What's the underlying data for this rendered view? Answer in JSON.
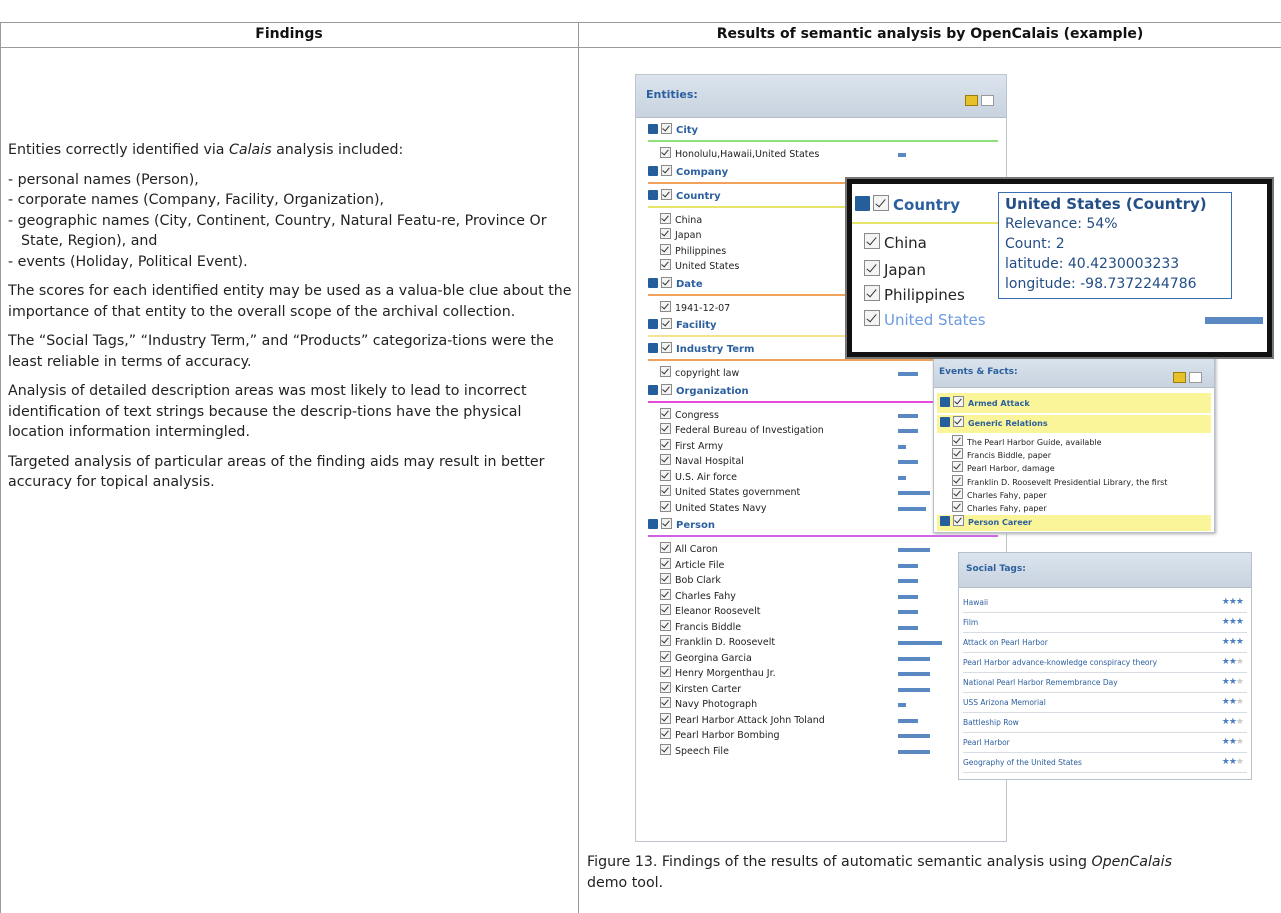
{
  "table": {
    "col1_header": "Findings",
    "col2_header": "Results of semantic analysis by OpenCalais (example)"
  },
  "findings": {
    "intro_prefix": "Entities correctly identified via ",
    "intro_italic": "Calais",
    "intro_suffix": " analysis included:",
    "list": [
      "- personal names (Person),",
      "- corporate names (Company, Facility, Organization),",
      "- geographic names (City, Continent, Country, Natural Featu-re, Province Or State, Region), and",
      "- events (Holiday, Political Event)."
    ],
    "paragraphs": [
      "The scores for each identified entity may be used as a valua-ble clue about the importance of that entity to the overall scope of the archival collection.",
      "The “Social Tags,” “Industry Term,” and “Products” categoriza-tions were the least reliable in terms of accuracy.",
      "Analysis of detailed description areas was most likely to lead to incorrect identification of text strings because the descrip-tions have the physical location information intermingled.",
      "Targeted analysis of particular areas of the finding aids may result in better accuracy for topical analysis."
    ]
  },
  "caption": {
    "prefix": "Figure 13. Findings of the results of automatic semantic analysis using ",
    "italic": "OpenCalais",
    "line2": "demo tool."
  },
  "entities_panel": {
    "title": "Entities:",
    "categories": {
      "city": "City",
      "company": "Company",
      "country": "Country",
      "date": "Date",
      "facility": "Facility",
      "industry": "Industry Term",
      "organization": "Organization",
      "person": "Person"
    },
    "city_items": [
      "Honolulu,Hawaii,United States"
    ],
    "country_items": [
      "China",
      "Japan",
      "Philippines",
      "United States"
    ],
    "date_items": [
      "1941-12-07"
    ],
    "industry_items": [
      "copyright law"
    ],
    "organization_items": [
      "Congress",
      "Federal Bureau of Investigation",
      "First Army",
      "Naval Hospital",
      "U.S. Air force",
      "United States government",
      "United States Navy"
    ],
    "person_items": [
      "All Caron",
      "Article File",
      "Bob Clark",
      "Charles Fahy",
      "Eleanor Roosevelt",
      "Francis Biddle",
      "Franklin D. Roosevelt",
      "Georgina Garcia",
      "Henry Morgenthau Jr.",
      "Kirsten Carter",
      "Navy Photograph",
      "Pearl Harbor Attack John Toland",
      "Pearl Harbor Bombing",
      "Speech File"
    ]
  },
  "country_popup": {
    "category": "Country",
    "items": [
      "China",
      "Japan",
      "Philippines",
      "United States"
    ],
    "tooltip": {
      "title": "United States (Country)",
      "relevance": "Relevance: 54%",
      "count": "Count: 2",
      "latitude": "latitude: 40.4230003233",
      "longitude": "longitude: -98.7372244786"
    }
  },
  "events_panel": {
    "title": "Events & Facts:",
    "armed_attack": "Armed Attack",
    "generic_relations": "Generic Relations",
    "items": [
      "The Pearl Harbor Guide, available",
      "Francis Biddle, paper",
      "Pearl Harbor, damage",
      "Franklin D. Roosevelt Presidential Library, the first",
      "Charles Fahy, paper",
      "Charles Fahy, paper"
    ],
    "person_career": "Person Career"
  },
  "social_tags": {
    "title": "Social Tags:",
    "tags": [
      {
        "label": "Hawaii",
        "stars": 3
      },
      {
        "label": "Film",
        "stars": 3
      },
      {
        "label": "Attack on Pearl Harbor",
        "stars": 3
      },
      {
        "label": "Pearl Harbor advance-knowledge conspiracy theory",
        "stars": 2
      },
      {
        "label": "National Pearl Harbor Remembrance Day",
        "stars": 2
      },
      {
        "label": "USS Arizona Memorial",
        "stars": 2
      },
      {
        "label": "Battleship Row",
        "stars": 2
      },
      {
        "label": "Pearl Harbor",
        "stars": 2
      },
      {
        "label": "Geography of the United States",
        "stars": 2
      }
    ]
  },
  "colors": {
    "city": "#8ee07a",
    "company": "#f0a25a",
    "country": "#e6e56a",
    "date": "#f0a25a",
    "facility": "#f5e28a",
    "industry": "#f0a25a",
    "organization": "#e64ad6",
    "person": "#d060e8"
  }
}
